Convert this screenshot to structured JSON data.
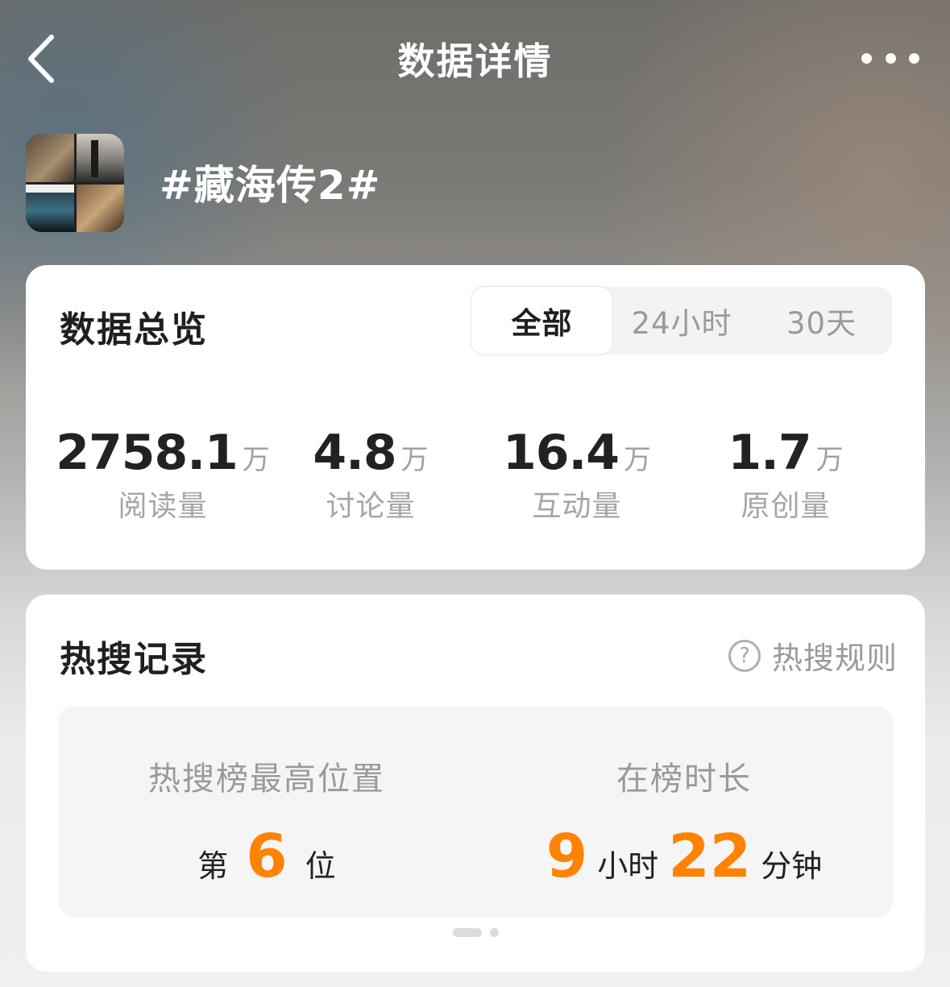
{
  "nav": {
    "title": "数据详情",
    "back_icon": "chevron-left-icon",
    "more_icon": "more-horizontal-icon"
  },
  "topic": {
    "title": "#藏海传2#"
  },
  "overview": {
    "title": "数据总览",
    "tabs": [
      {
        "label": "全部",
        "active": true
      },
      {
        "label": "24小时",
        "active": false
      },
      {
        "label": "30天",
        "active": false
      }
    ],
    "stats": [
      {
        "value": "2758.1",
        "unit": "万",
        "label": "阅读量"
      },
      {
        "value": "4.8",
        "unit": "万",
        "label": "讨论量"
      },
      {
        "value": "16.4",
        "unit": "万",
        "label": "互动量"
      },
      {
        "value": "1.7",
        "unit": "万",
        "label": "原创量"
      }
    ]
  },
  "hot_search": {
    "title": "热搜记录",
    "rules_label": "热搜规则",
    "rules_icon": "question-circle-icon",
    "peak": {
      "label": "热搜榜最高位置",
      "prefix": "第",
      "value": "6",
      "suffix": "位"
    },
    "duration": {
      "label": "在榜时长",
      "hours": "9",
      "hours_unit": "小时",
      "minutes": "22",
      "minutes_unit": "分钟"
    },
    "accent_color": "#ff8200"
  }
}
